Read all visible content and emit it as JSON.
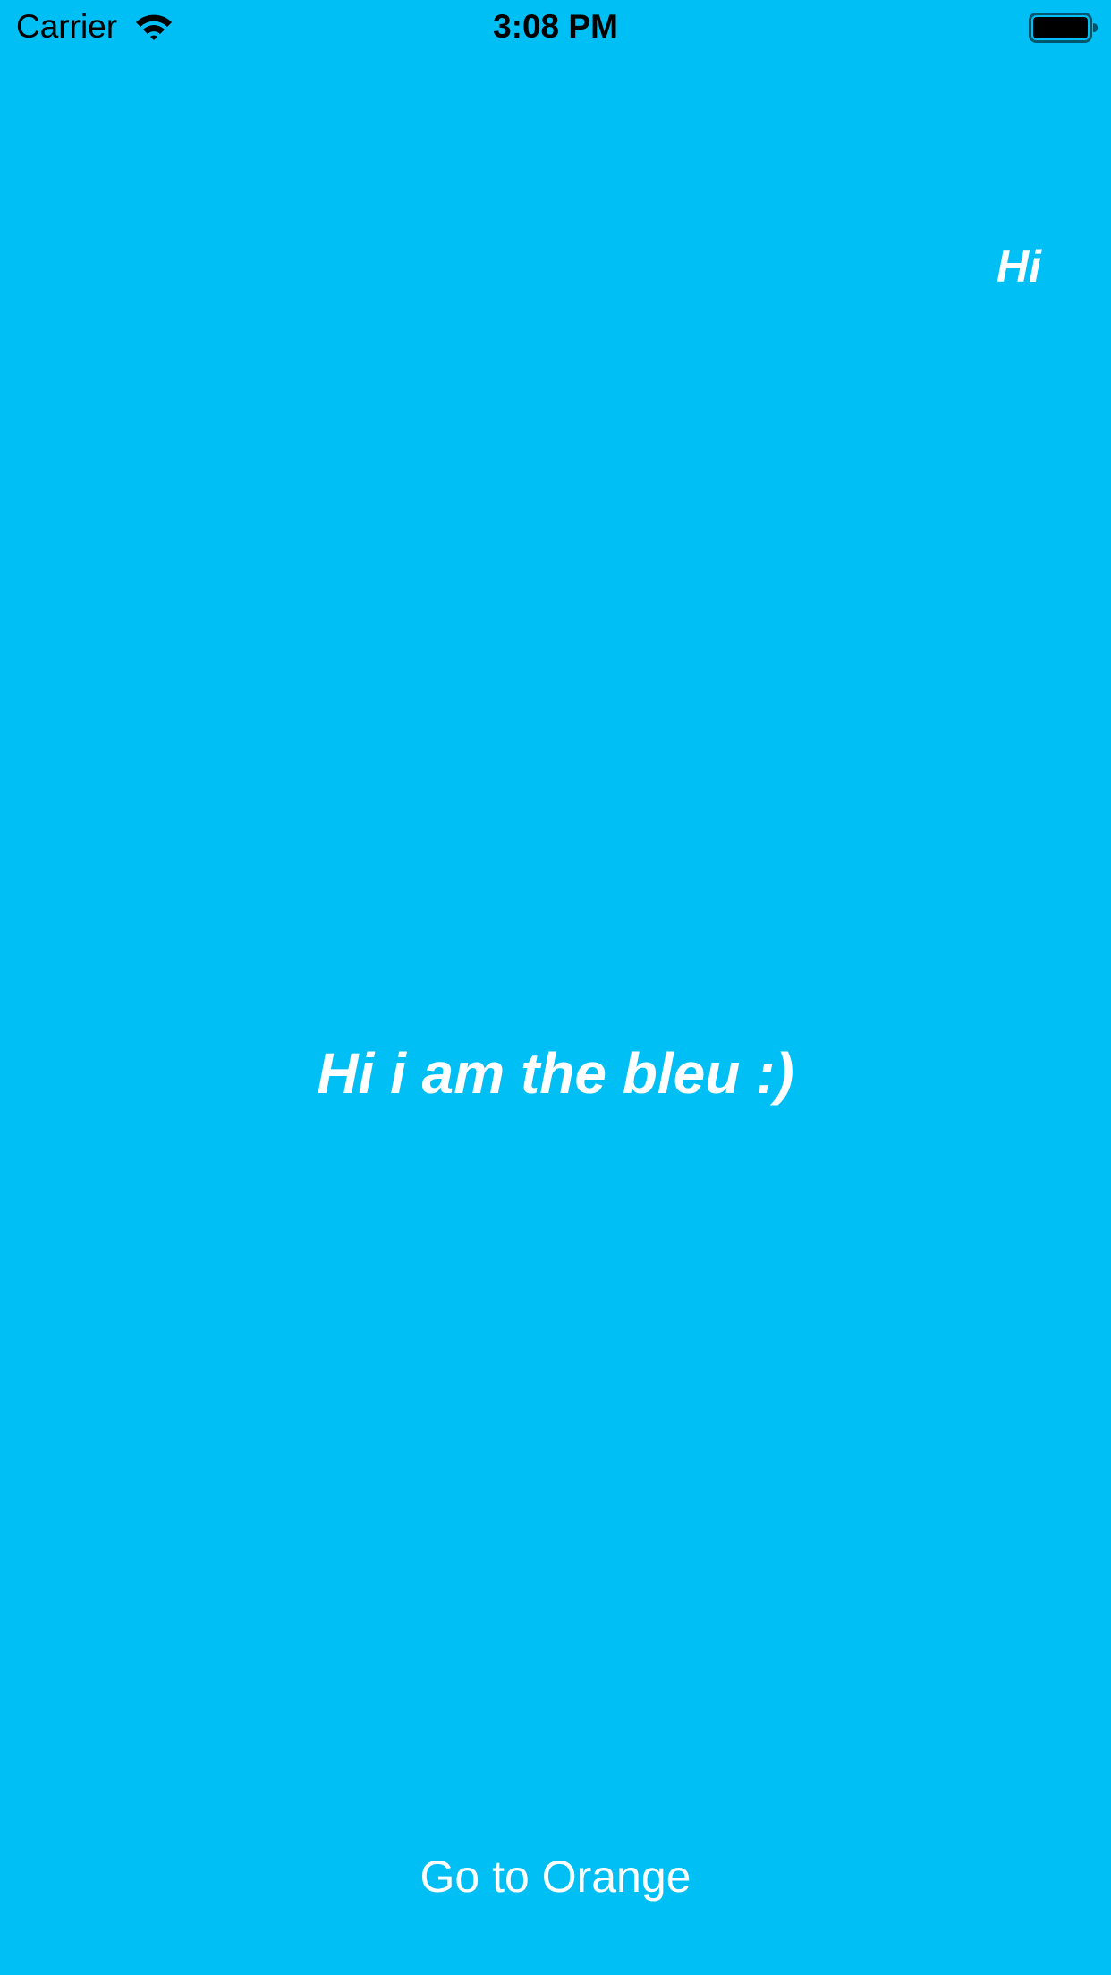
{
  "status_bar": {
    "carrier": "Carrier",
    "time": "3:08 PM",
    "icons": [
      "wifi-icon",
      "battery-icon"
    ]
  },
  "screen": {
    "background_color": "#00bff5",
    "text_color": "#ffffff",
    "corner_label": "Hi",
    "main_label": "Hi i am the bleu :)",
    "button_label": "Go to Orange"
  }
}
